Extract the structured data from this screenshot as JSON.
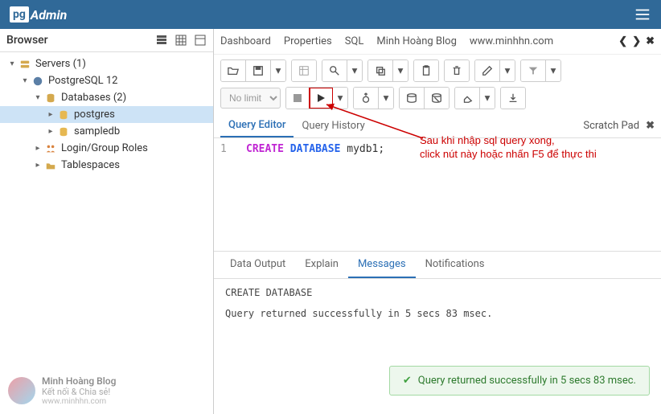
{
  "header": {
    "logo_prefix": "pg",
    "logo_suffix": "Admin"
  },
  "sidebar": {
    "title": "Browser",
    "tree": [
      {
        "label": "Servers (1)",
        "indent": 0,
        "expanded": true,
        "icon": "server",
        "selected": false
      },
      {
        "label": "PostgreSQL 12",
        "indent": 1,
        "expanded": true,
        "icon": "elephant",
        "selected": false
      },
      {
        "label": "Databases (2)",
        "indent": 2,
        "expanded": true,
        "icon": "db",
        "selected": false
      },
      {
        "label": "postgres",
        "indent": 3,
        "expanded": false,
        "icon": "db-gold",
        "selected": true
      },
      {
        "label": "sampledb",
        "indent": 3,
        "expanded": false,
        "icon": "db-gold",
        "selected": false
      },
      {
        "label": "Login/Group Roles",
        "indent": 2,
        "expanded": false,
        "icon": "roles",
        "selected": false
      },
      {
        "label": "Tablespaces",
        "indent": 2,
        "expanded": false,
        "icon": "tablespace",
        "selected": false
      }
    ],
    "footer": {
      "line1": "Minh Hoàng Blog",
      "line2": "Kết nối & Chia sẻ!",
      "line3": "www.minhhn.com"
    }
  },
  "topTabs": [
    "Dashboard",
    "Properties",
    "SQL",
    "Minh Hoàng Blog",
    "www.minhhn.com"
  ],
  "toolbar": {
    "nolimit_label": "No limit"
  },
  "editorTabs": {
    "tab1": "Query Editor",
    "tab2": "Query History",
    "scratch": "Scratch Pad"
  },
  "editor": {
    "line_num": "1",
    "kw_create": "CREATE",
    "kw_database": "DATABASE",
    "ident": "mydb1;"
  },
  "annotation": {
    "line1": "Sau khi nhập sql query xong,",
    "line2": "click nút này hoặc nhấn F5 để thực thi"
  },
  "resultTabs": {
    "t1": "Data Output",
    "t2": "Explain",
    "t3": "Messages",
    "t4": "Notifications"
  },
  "messages": {
    "line1": "CREATE DATABASE",
    "line2": "Query returned successfully in 5 secs 83 msec."
  },
  "successBar": "Query returned successfully in 5 secs 83 msec."
}
